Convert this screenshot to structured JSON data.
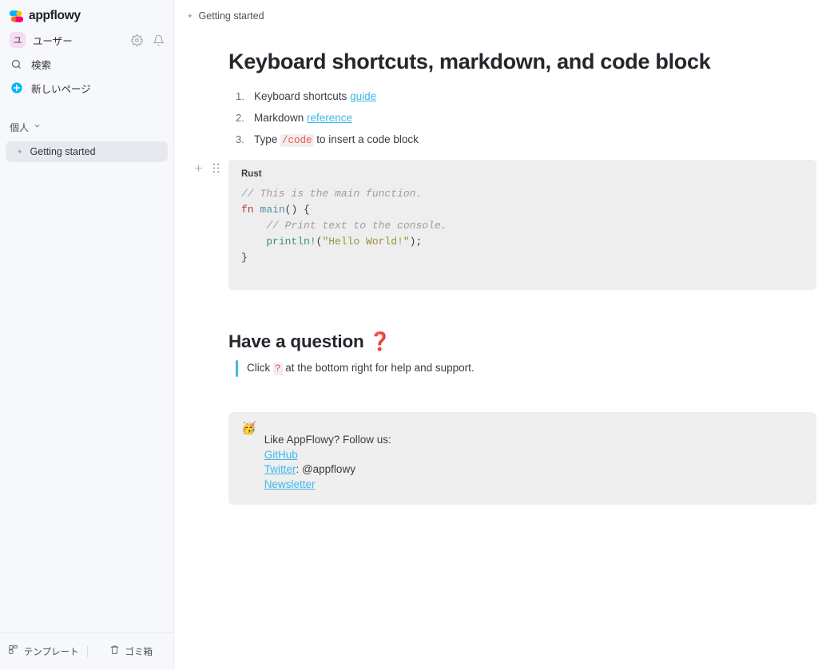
{
  "app": {
    "logo_text": "appflowy",
    "logo_icon": "appflowy-pinwheel-logo"
  },
  "sidebar": {
    "user": {
      "avatar_initial": "ユ",
      "name": "ユーザー",
      "settings_icon": "gear-icon",
      "notification_icon": "bell-icon"
    },
    "nav": [
      {
        "icon": "search-icon",
        "label": "検索"
      },
      {
        "icon": "plus-circle-icon",
        "label": "新しいページ"
      }
    ],
    "section": {
      "title": "個人",
      "chevron_icon": "chevron-down-icon"
    },
    "pages": [
      {
        "icon": "star-icon",
        "label": "Getting started",
        "active": true
      }
    ],
    "footer": [
      {
        "icon": "template-icon",
        "label": "テンプレート"
      },
      {
        "icon": "trash-icon",
        "label": "ゴミ箱"
      }
    ]
  },
  "topbar": {
    "breadcrumb_icon": "star-icon",
    "breadcrumb": "Getting started"
  },
  "document": {
    "title": "Keyboard shortcuts, markdown, and code block",
    "list": [
      {
        "num": "1.",
        "pre": "Keyboard shortcuts ",
        "link": "guide",
        "post": ""
      },
      {
        "num": "2.",
        "pre": "Markdown ",
        "link": "reference",
        "post": ""
      },
      {
        "num": "3.",
        "pre": "Type ",
        "code": "/code",
        "post": " to insert a code block"
      }
    ],
    "block_controls": {
      "add_icon": "plus-icon",
      "drag_icon": "drag-handle-icon"
    },
    "code_block": {
      "language": "Rust",
      "lines": [
        {
          "comment": "// This is the main function."
        },
        {
          "keyword": "fn",
          "fn": "main",
          "punct": "() {"
        },
        {
          "indent": "    ",
          "comment": "// Print text to the console."
        },
        {
          "indent": "    ",
          "macro": "println!",
          "punct_open": "(",
          "string": "\"Hello World!\"",
          "punct_close": ");"
        },
        {
          "punct": "}"
        }
      ]
    },
    "question_heading": {
      "text": "Have a question ",
      "emoji": "❓"
    },
    "quote": {
      "pre": "Click ",
      "code": "?",
      "post": " at the bottom right for help and support."
    },
    "callout": {
      "emoji": "🥳",
      "intro": "Like AppFlowy? Follow us:",
      "links": [
        {
          "link": "GitHub",
          "suffix": ""
        },
        {
          "link": "Twitter",
          "suffix": ": @appflowy"
        },
        {
          "link": "Newsletter",
          "suffix": ""
        }
      ]
    }
  },
  "colors": {
    "link": "#3eb8e8",
    "accent_red": "#ef5350",
    "sidebar_bg": "#f7f8fc",
    "code_bg": "#eeeeee"
  }
}
